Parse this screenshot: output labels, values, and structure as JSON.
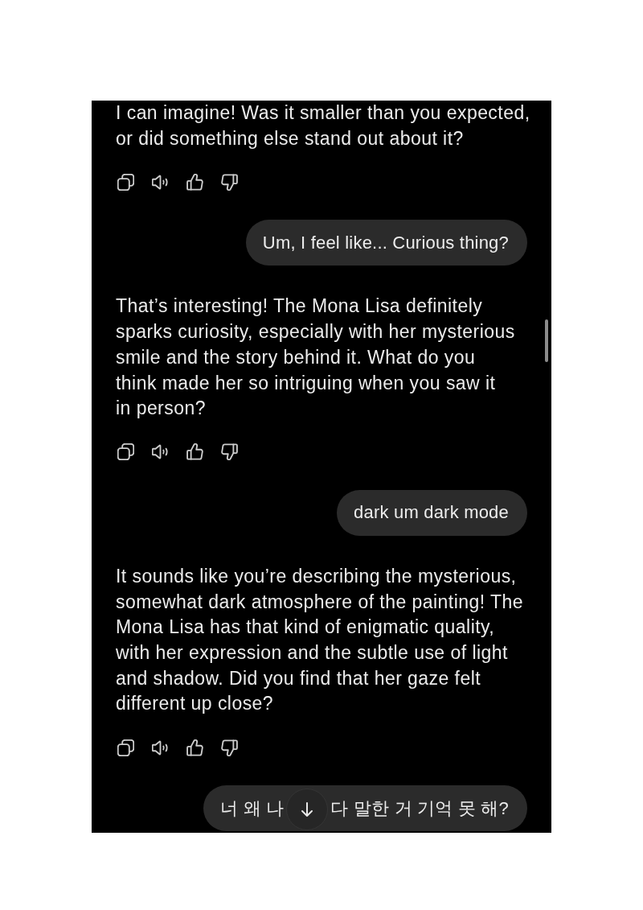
{
  "chat": {
    "messages": [
      {
        "kind": "assistant",
        "text": "I can imagine! Was it smaller than you expected,\nor did something else stand out about it?"
      },
      {
        "kind": "user",
        "parts": [
          "Um, I feel like... Curious thing?"
        ]
      },
      {
        "kind": "assistant",
        "text": "That’s interesting! The Mona Lisa definitely\nsparks curiosity, especially with her mysterious\nsmile and the story behind it. What do you\nthink made her so intriguing when you saw it\nin person?"
      },
      {
        "kind": "user",
        "parts": [
          "dark um dark mode"
        ]
      },
      {
        "kind": "assistant",
        "text": "It sounds like you’re describing the mysterious,\nsomewhat dark atmosphere of the painting! The\nMona Lisa has that kind of enigmatic quality,\nwith her expression and the subtle use of light\nand shadow. Did you find that her gaze felt\ndifferent up close?"
      },
      {
        "kind": "user",
        "parts": [
          "너 왜 나",
          "다 말한 거 기억 못 해?"
        ]
      }
    ],
    "scroll_down_button_shown": true
  }
}
